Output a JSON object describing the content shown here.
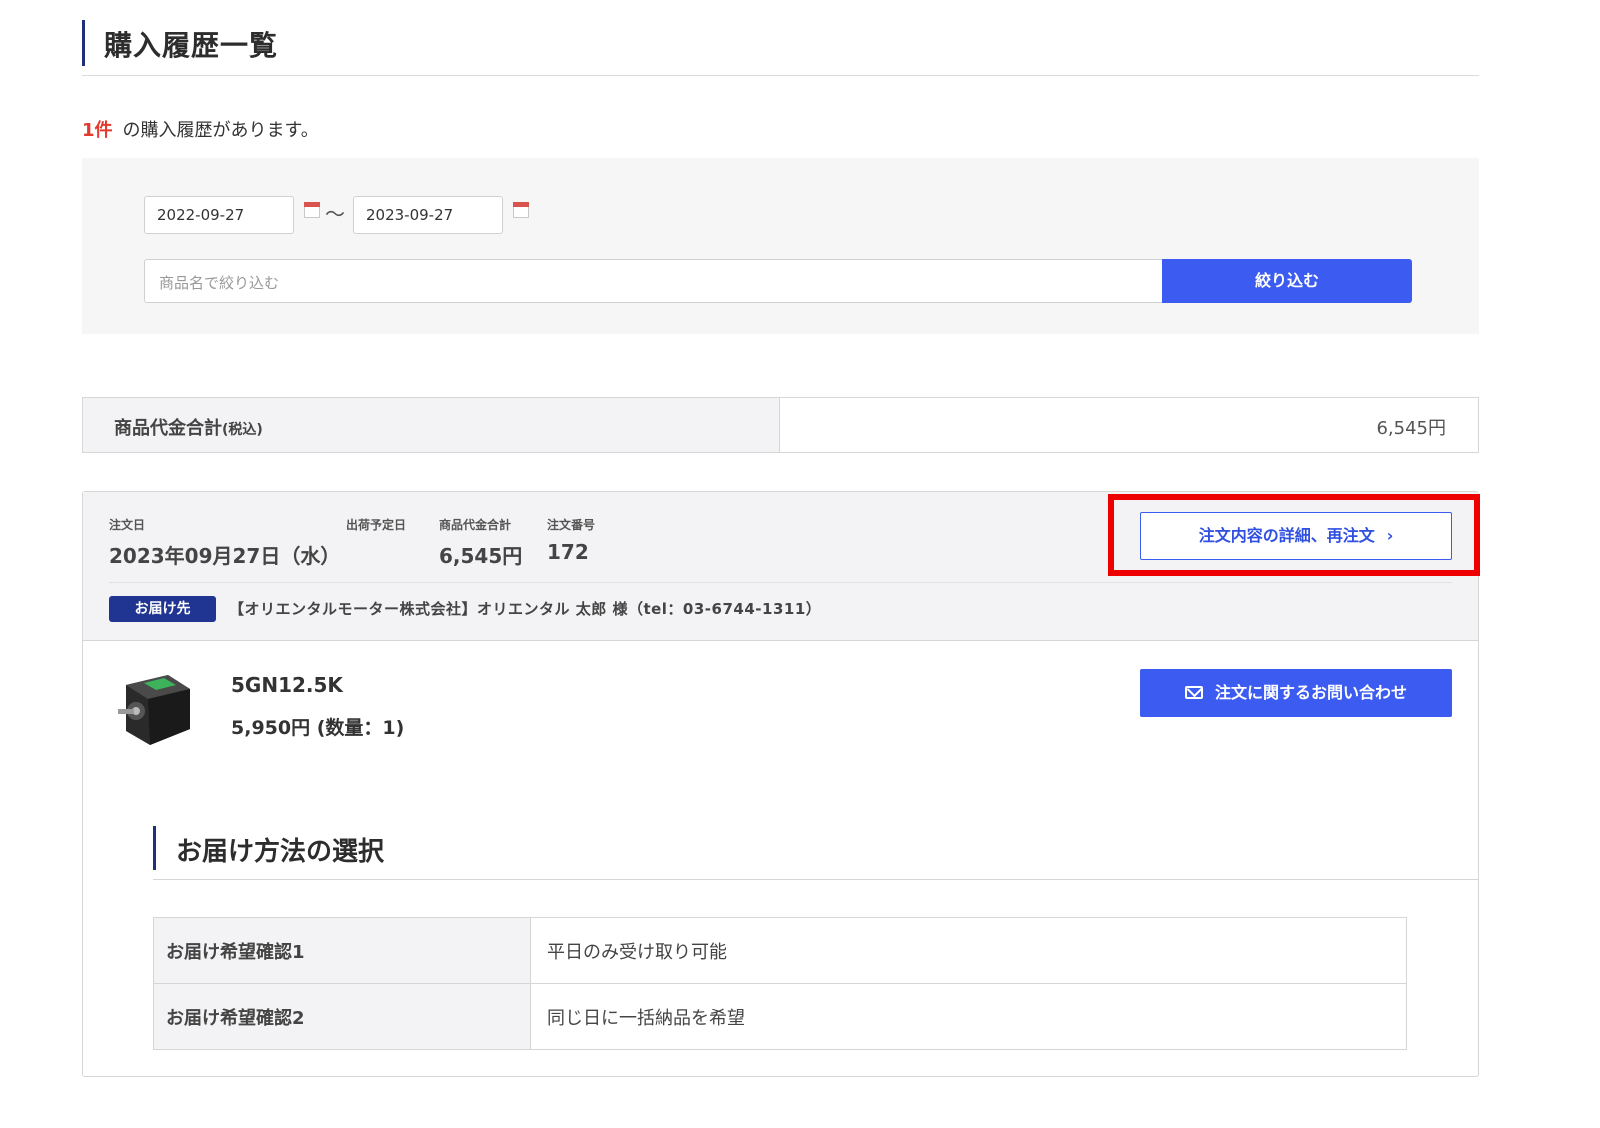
{
  "header": {
    "title": "購入履歴一覧"
  },
  "summary": {
    "count": "1件",
    "text": "の購入履歴があります。"
  },
  "filter": {
    "date_from": "2022-09-27",
    "date_separator": "〜",
    "date_to": "2023-09-27",
    "keyword_placeholder": "商品名で絞り込む",
    "button_label": "絞り込む"
  },
  "total": {
    "label": "商品代金合計",
    "label_tax": "(税込)",
    "value": "6,545円"
  },
  "order": {
    "order_date_label": "注文日",
    "order_date": "2023年09月27日（水）",
    "ship_date_label": "出荷予定日",
    "ship_date": "",
    "subtotal_label": "商品代金合計",
    "subtotal": "6,545円",
    "order_no_label": "注文番号",
    "order_no": "172",
    "detail_button": "注文内容の詳細、再注文",
    "dest_badge": "お届け先",
    "dest_text": "【オリエンタルモーター株式会社】オリエンタル 太郎 様（tel：03-6744-1311）",
    "highlight_color": "#ee0000"
  },
  "product": {
    "name": "5GN12.5K",
    "price_line": "5,950円 (数量：1)",
    "image_icon": "gear-motor-image"
  },
  "inquiry_button": "注文に関するお問い合わせ",
  "delivery": {
    "title": "お届け方法の選択",
    "rows": [
      {
        "label": "お届け希望確認1",
        "value": "平日のみ受け取り可能"
      },
      {
        "label": "お届け希望確認2",
        "value": "同じ日に一括納品を希望"
      }
    ]
  },
  "colors": {
    "accent": "#3c5bf0",
    "navy": "#1f3591",
    "count_red": "#e23b2e"
  }
}
